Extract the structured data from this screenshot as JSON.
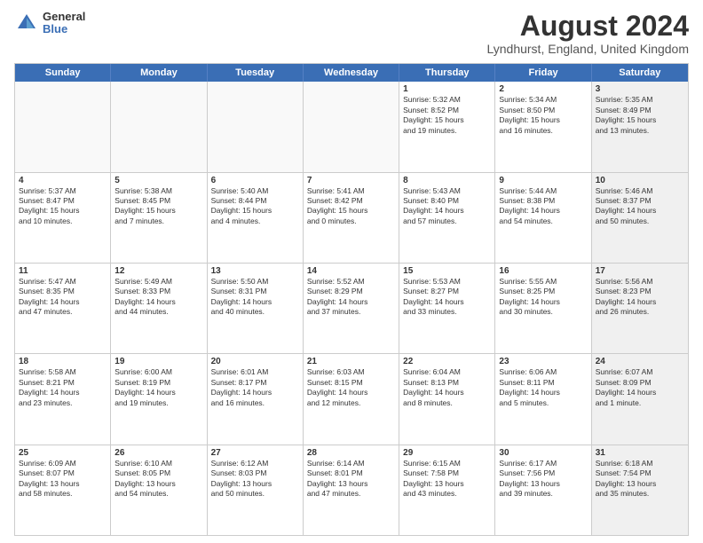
{
  "logo": {
    "general": "General",
    "blue": "Blue"
  },
  "title": "August 2024",
  "location": "Lyndhurst, England, United Kingdom",
  "days_of_week": [
    "Sunday",
    "Monday",
    "Tuesday",
    "Wednesday",
    "Thursday",
    "Friday",
    "Saturday"
  ],
  "weeks": [
    [
      {
        "day": "",
        "info": "",
        "empty": true
      },
      {
        "day": "",
        "info": "",
        "empty": true
      },
      {
        "day": "",
        "info": "",
        "empty": true
      },
      {
        "day": "",
        "info": "",
        "empty": true
      },
      {
        "day": "1",
        "info": "Sunrise: 5:32 AM\nSunset: 8:52 PM\nDaylight: 15 hours\nand 19 minutes."
      },
      {
        "day": "2",
        "info": "Sunrise: 5:34 AM\nSunset: 8:50 PM\nDaylight: 15 hours\nand 16 minutes."
      },
      {
        "day": "3",
        "info": "Sunrise: 5:35 AM\nSunset: 8:49 PM\nDaylight: 15 hours\nand 13 minutes.",
        "shaded": true
      }
    ],
    [
      {
        "day": "4",
        "info": "Sunrise: 5:37 AM\nSunset: 8:47 PM\nDaylight: 15 hours\nand 10 minutes."
      },
      {
        "day": "5",
        "info": "Sunrise: 5:38 AM\nSunset: 8:45 PM\nDaylight: 15 hours\nand 7 minutes."
      },
      {
        "day": "6",
        "info": "Sunrise: 5:40 AM\nSunset: 8:44 PM\nDaylight: 15 hours\nand 4 minutes."
      },
      {
        "day": "7",
        "info": "Sunrise: 5:41 AM\nSunset: 8:42 PM\nDaylight: 15 hours\nand 0 minutes."
      },
      {
        "day": "8",
        "info": "Sunrise: 5:43 AM\nSunset: 8:40 PM\nDaylight: 14 hours\nand 57 minutes."
      },
      {
        "day": "9",
        "info": "Sunrise: 5:44 AM\nSunset: 8:38 PM\nDaylight: 14 hours\nand 54 minutes."
      },
      {
        "day": "10",
        "info": "Sunrise: 5:46 AM\nSunset: 8:37 PM\nDaylight: 14 hours\nand 50 minutes.",
        "shaded": true
      }
    ],
    [
      {
        "day": "11",
        "info": "Sunrise: 5:47 AM\nSunset: 8:35 PM\nDaylight: 14 hours\nand 47 minutes."
      },
      {
        "day": "12",
        "info": "Sunrise: 5:49 AM\nSunset: 8:33 PM\nDaylight: 14 hours\nand 44 minutes."
      },
      {
        "day": "13",
        "info": "Sunrise: 5:50 AM\nSunset: 8:31 PM\nDaylight: 14 hours\nand 40 minutes."
      },
      {
        "day": "14",
        "info": "Sunrise: 5:52 AM\nSunset: 8:29 PM\nDaylight: 14 hours\nand 37 minutes."
      },
      {
        "day": "15",
        "info": "Sunrise: 5:53 AM\nSunset: 8:27 PM\nDaylight: 14 hours\nand 33 minutes."
      },
      {
        "day": "16",
        "info": "Sunrise: 5:55 AM\nSunset: 8:25 PM\nDaylight: 14 hours\nand 30 minutes."
      },
      {
        "day": "17",
        "info": "Sunrise: 5:56 AM\nSunset: 8:23 PM\nDaylight: 14 hours\nand 26 minutes.",
        "shaded": true
      }
    ],
    [
      {
        "day": "18",
        "info": "Sunrise: 5:58 AM\nSunset: 8:21 PM\nDaylight: 14 hours\nand 23 minutes."
      },
      {
        "day": "19",
        "info": "Sunrise: 6:00 AM\nSunset: 8:19 PM\nDaylight: 14 hours\nand 19 minutes."
      },
      {
        "day": "20",
        "info": "Sunrise: 6:01 AM\nSunset: 8:17 PM\nDaylight: 14 hours\nand 16 minutes."
      },
      {
        "day": "21",
        "info": "Sunrise: 6:03 AM\nSunset: 8:15 PM\nDaylight: 14 hours\nand 12 minutes."
      },
      {
        "day": "22",
        "info": "Sunrise: 6:04 AM\nSunset: 8:13 PM\nDaylight: 14 hours\nand 8 minutes."
      },
      {
        "day": "23",
        "info": "Sunrise: 6:06 AM\nSunset: 8:11 PM\nDaylight: 14 hours\nand 5 minutes."
      },
      {
        "day": "24",
        "info": "Sunrise: 6:07 AM\nSunset: 8:09 PM\nDaylight: 14 hours\nand 1 minute.",
        "shaded": true
      }
    ],
    [
      {
        "day": "25",
        "info": "Sunrise: 6:09 AM\nSunset: 8:07 PM\nDaylight: 13 hours\nand 58 minutes."
      },
      {
        "day": "26",
        "info": "Sunrise: 6:10 AM\nSunset: 8:05 PM\nDaylight: 13 hours\nand 54 minutes."
      },
      {
        "day": "27",
        "info": "Sunrise: 6:12 AM\nSunset: 8:03 PM\nDaylight: 13 hours\nand 50 minutes."
      },
      {
        "day": "28",
        "info": "Sunrise: 6:14 AM\nSunset: 8:01 PM\nDaylight: 13 hours\nand 47 minutes."
      },
      {
        "day": "29",
        "info": "Sunrise: 6:15 AM\nSunset: 7:58 PM\nDaylight: 13 hours\nand 43 minutes."
      },
      {
        "day": "30",
        "info": "Sunrise: 6:17 AM\nSunset: 7:56 PM\nDaylight: 13 hours\nand 39 minutes."
      },
      {
        "day": "31",
        "info": "Sunrise: 6:18 AM\nSunset: 7:54 PM\nDaylight: 13 hours\nand 35 minutes.",
        "shaded": true
      }
    ]
  ]
}
